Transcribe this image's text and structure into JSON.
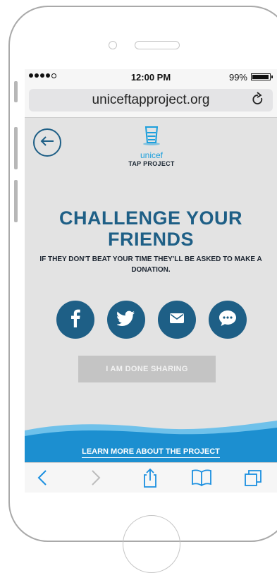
{
  "status": {
    "time": "12:00 PM",
    "battery": "99%"
  },
  "browser": {
    "url": "uniceftapproject.org"
  },
  "logo": {
    "brand": "unicef",
    "subtitle": "TAP PROJECT"
  },
  "content": {
    "headline": "CHALLENGE YOUR FRIENDS",
    "subline": "IF THEY DON'T BEAT YOUR TIME THEY'LL BE ASKED TO MAKE A DONATION.",
    "done_label": "I AM DONE SHARING",
    "learn_label": "LEARN MORE ABOUT THE PROJECT"
  },
  "colors": {
    "primary": "#1e5f86",
    "accent": "#1c9fdc",
    "background": "#e3e3e3",
    "disabled": "#c4c4c4"
  },
  "icons": [
    "back-arrow-icon",
    "facebook-icon",
    "twitter-icon",
    "mail-icon",
    "chat-icon",
    "reload-icon",
    "share-icon",
    "bookmarks-icon",
    "tabs-icon"
  ]
}
